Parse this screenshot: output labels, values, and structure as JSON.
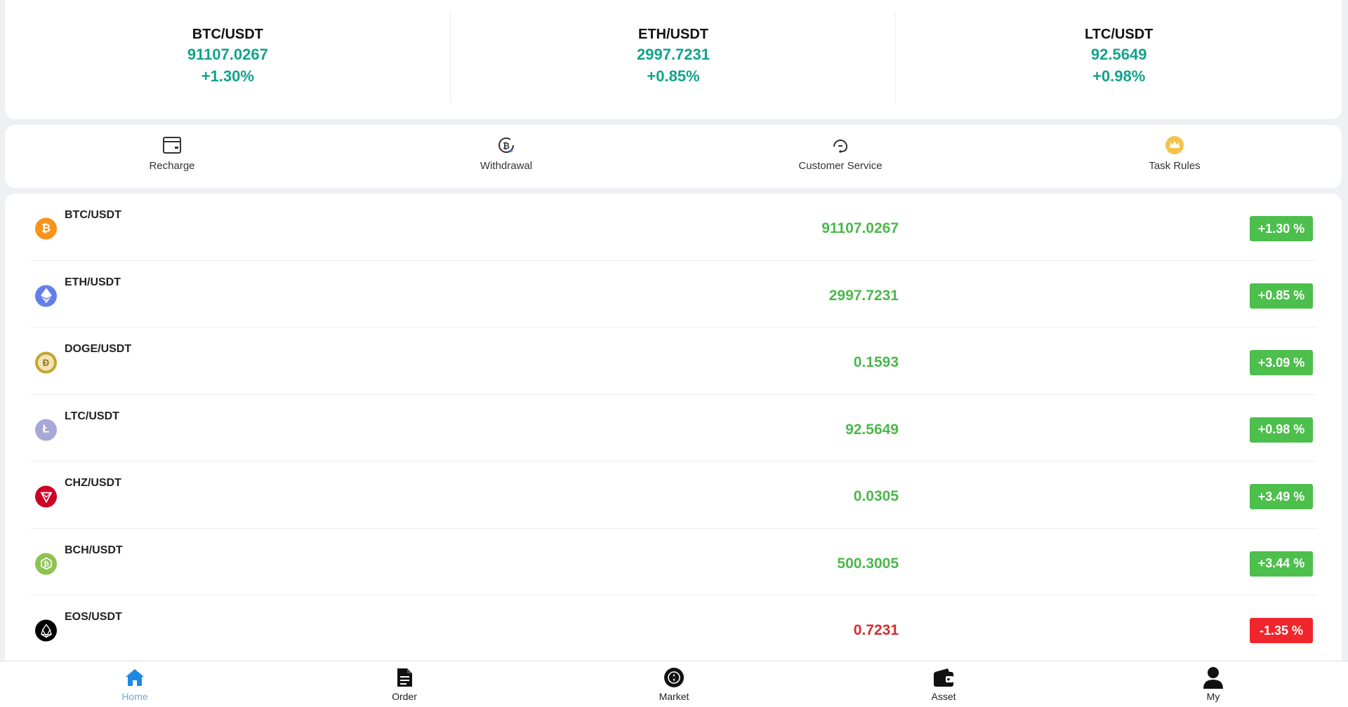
{
  "tickers": [
    {
      "pair": "BTC/USDT",
      "price": "91107.0267",
      "change": "+1.30%"
    },
    {
      "pair": "ETH/USDT",
      "price": "2997.7231",
      "change": "+0.85%"
    },
    {
      "pair": "LTC/USDT",
      "price": "92.5649",
      "change": "+0.98%"
    }
  ],
  "actions": [
    {
      "label": "Recharge",
      "icon": "wallet-card-icon"
    },
    {
      "label": "Withdrawal",
      "icon": "bitcoin-withdraw-icon"
    },
    {
      "label": "Customer Service",
      "icon": "headset-icon"
    },
    {
      "label": "Task Rules",
      "icon": "crown-icon"
    }
  ],
  "market": [
    {
      "pair": "BTC/USDT",
      "price": "91107.0267",
      "change": "+1.30 %",
      "trend": "up",
      "icon": "bitcoin-icon",
      "icon_color": "#f7931a"
    },
    {
      "pair": "ETH/USDT",
      "price": "2997.7231",
      "change": "+0.85 %",
      "trend": "up",
      "icon": "ethereum-icon",
      "icon_color": "#627eea"
    },
    {
      "pair": "DOGE/USDT",
      "price": "0.1593",
      "change": "+3.09 %",
      "trend": "up",
      "icon": "dogecoin-icon",
      "icon_color": "#c2a633"
    },
    {
      "pair": "LTC/USDT",
      "price": "92.5649",
      "change": "+0.98 %",
      "trend": "up",
      "icon": "litecoin-icon",
      "icon_color": "#a6a9d6"
    },
    {
      "pair": "CHZ/USDT",
      "price": "0.0305",
      "change": "+3.49 %",
      "trend": "up",
      "icon": "chiliz-icon",
      "icon_color": "#cd0124"
    },
    {
      "pair": "BCH/USDT",
      "price": "500.3005",
      "change": "+3.44 %",
      "trend": "up",
      "icon": "bitcoin-cash-icon",
      "icon_color": "#8dc351"
    },
    {
      "pair": "EOS/USDT",
      "price": "0.7231",
      "change": "-1.35 %",
      "trend": "down",
      "icon": "eos-icon",
      "icon_color": "#000000"
    }
  ],
  "nav": [
    {
      "label": "Home",
      "icon": "home-icon",
      "active": true
    },
    {
      "label": "Order",
      "icon": "document-icon",
      "active": false
    },
    {
      "label": "Market",
      "icon": "market-icon",
      "active": false
    },
    {
      "label": "Asset",
      "icon": "wallet-icon",
      "active": false
    },
    {
      "label": "My",
      "icon": "user-icon",
      "active": false
    }
  ],
  "colors": {
    "ticker_green": "#12a28c",
    "price_up": "#4cb84c",
    "price_down": "#d42d2d",
    "badge_up": "#4cbf4c",
    "badge_down": "#f0262c",
    "nav_active": "#6fa9d8"
  }
}
